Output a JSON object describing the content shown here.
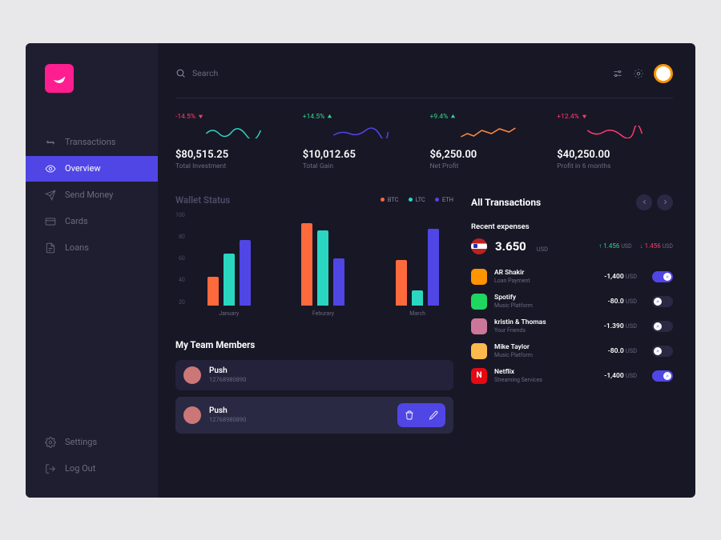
{
  "sidebar": {
    "items": [
      {
        "label": "Transactions",
        "icon": "swap-icon"
      },
      {
        "label": "Overview",
        "icon": "eye-icon"
      },
      {
        "label": "Send Money",
        "icon": "send-icon"
      },
      {
        "label": "Cards",
        "icon": "card-icon"
      },
      {
        "label": "Loans",
        "icon": "document-icon"
      }
    ],
    "bottom": [
      {
        "label": "Settings",
        "icon": "gear-icon"
      },
      {
        "label": "Log Out",
        "icon": "logout-icon"
      }
    ]
  },
  "search": {
    "placeholder": "Search"
  },
  "stats": [
    {
      "change": "-14.5%",
      "direction": "down",
      "color": "red",
      "value": "$80,515.25",
      "label": "Total Investment",
      "spark_color": "#2bd6c0"
    },
    {
      "change": "+14.5%",
      "direction": "up",
      "color": "green",
      "value": "$10,012.65",
      "label": "Total Gain",
      "spark_color": "#5046e5"
    },
    {
      "change": "+9.4%",
      "direction": "up",
      "color": "green",
      "value": "$6,250.00",
      "label": "Net Profit",
      "spark_color": "#ff8a3d"
    },
    {
      "change": "+12.4%",
      "direction": "down",
      "color": "red",
      "value": "$40,250.00",
      "label": "Profit in 6 months",
      "spark_color": "#ff3b6b"
    }
  ],
  "wallet": {
    "title": "Wallet Status",
    "legend": [
      {
        "label": "BTC",
        "color": "#ff6a3d"
      },
      {
        "label": "LTC",
        "color": "#2bd6c0"
      },
      {
        "label": "ETH",
        "color": "#5046e5"
      }
    ]
  },
  "chart_data": {
    "type": "bar",
    "ylim": [
      0,
      100
    ],
    "ticks": [
      100,
      80,
      60,
      40,
      20
    ],
    "categories": [
      "January",
      "Feburary",
      "March"
    ],
    "series": [
      {
        "name": "BTC",
        "color": "#ff6a3d",
        "values": [
          30,
          88,
          48
        ]
      },
      {
        "name": "LTC",
        "color": "#2bd6c0",
        "values": [
          55,
          80,
          16
        ]
      },
      {
        "name": "ETH",
        "color": "#5046e5",
        "values": [
          70,
          50,
          82
        ]
      }
    ]
  },
  "team": {
    "title": "My Team Members",
    "members": [
      {
        "name": "Push",
        "sub": "12768980890"
      },
      {
        "name": "Push",
        "sub": "12768980890"
      }
    ]
  },
  "transactions": {
    "title": "All Transactions",
    "recent_label": "Recent expenses",
    "summary": {
      "value": "3.650",
      "unit": "USD"
    },
    "up": {
      "value": "1.456",
      "unit": "USD"
    },
    "down": {
      "value": "1.456",
      "unit": "USD"
    },
    "items": [
      {
        "name": "AR Shakir",
        "sub": "Loan Payment",
        "amount": "-1,400",
        "unit": "USD",
        "avatar_bg": "#ff9500",
        "toggle": true
      },
      {
        "name": "Spotify",
        "sub": "Music Platform",
        "amount": "-80.0",
        "unit": "USD",
        "avatar_bg": "#1ed760",
        "toggle": false
      },
      {
        "name": "kristin & Thomas",
        "sub": "Your Friends",
        "amount": "-1.390",
        "unit": "USD",
        "avatar_bg": "#c79",
        "toggle": false
      },
      {
        "name": "Mike Taylor",
        "sub": "Music Platform",
        "amount": "-80.0",
        "unit": "USD",
        "avatar_bg": "#ffb84d",
        "toggle": false
      },
      {
        "name": "Netflix",
        "sub": "Streaming Services",
        "amount": "-1,400",
        "unit": "USD",
        "avatar_bg": "#e50914",
        "avatar_letter": "N",
        "toggle": true
      }
    ]
  }
}
